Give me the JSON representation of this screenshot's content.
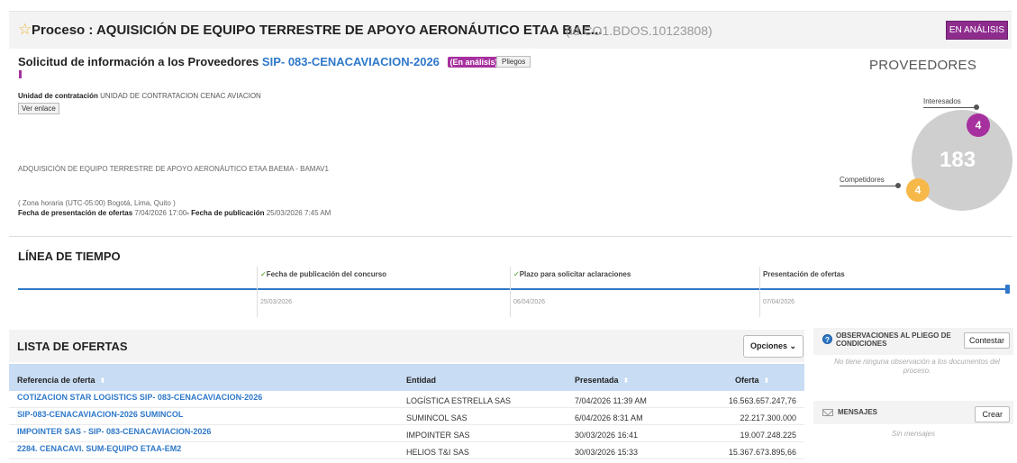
{
  "header": {
    "star_glyph": "☆",
    "title": "Proceso : AQUISICIÓN DE EQUIPO TERRESTRE DE APOYO AERONÁUTICO ETAA BAE...",
    "id": "(id.CO1.BDOS.10123808)",
    "status": "EN ANÁLISIS"
  },
  "solicitud": {
    "label": "Solicitud de información a los Proveedores",
    "code": "SIP- 083-CENACAVIACION-2026",
    "status_pill": "(En análisis)",
    "pliegos_button": "Pliegos",
    "unidad_label": "Unidad de contratación",
    "unidad_value": "UNIDAD DE CONTRATACION CENAC AVIACION",
    "ver_enlace": "Ver enlace",
    "description": "ADQUISICIÓN DE EQUIPO TERRESTRE DE APOYO AERONÁUTICO ETAA BAEMA - BAMAV1",
    "timezone": "( Zona horaria  (UTC-05:00) Bogotá, Lima, Quito )",
    "fecha_presentacion_label": "Fecha de presentación de ofertas",
    "fecha_presentacion_value": "7/04/2026 17:00",
    "fecha_publicacion_label": "- Fecha de publicación",
    "fecha_publicacion_value": "25/03/2026 7:45 AM"
  },
  "proveedores": {
    "title": "PROVEEDORES",
    "total": "183",
    "interesados_label": "Interesados",
    "interesados_count": "4",
    "competidores_label": "Competidores",
    "competidores_count": "4",
    "colors": {
      "interesados": "#a7309f",
      "competidores": "#f7b84a",
      "total": "#cfcfcf"
    }
  },
  "timeline": {
    "title": "LÍNEA DE TIEMPO",
    "check_glyph": "✓",
    "events": [
      {
        "label": "Fecha de publicación del concurso",
        "date": "25/03/2026"
      },
      {
        "label": "Plazo para solicitar aclaraciones",
        "date": "06/04/2026"
      },
      {
        "label": "Presentación de ofertas",
        "date": "07/04/2026"
      }
    ]
  },
  "ofertas": {
    "title": "LISTA DE OFERTAS",
    "opciones_button": "Opciones",
    "chevron_glyph": "⌄",
    "sort_glyph": "⬍",
    "columns": {
      "referencia": "Referencia de oferta",
      "entidad": "Entidad",
      "presentada": "Presentada",
      "oferta": "Oferta"
    },
    "rows": [
      {
        "referencia": "COTIZACION STAR LOGISTICS SIP- 083-CENACAVIACION-2026",
        "entidad": "LOGÍSTICA ESTRELLA SAS",
        "presentada": "7/04/2026 11:39 AM",
        "oferta": "16.563.657.247,76"
      },
      {
        "referencia": "SIP-083-CENACAVIACION-2026 SUMINCOL",
        "entidad": "SUMINCOL SAS",
        "presentada": "6/04/2026 8:31 AM",
        "oferta": "22.217.300.000"
      },
      {
        "referencia": "IMPOINTER SAS - SIP- 083-CENACAVIACION-2026",
        "entidad": "IMPOINTER SAS",
        "presentada": "30/03/2026 16:41",
        "oferta": "19.007.248.225"
      },
      {
        "referencia": "2284. CENACAVI. SUM-EQUIPO ETAA-EM2",
        "entidad": "HELIOS T&I SAS",
        "presentada": "30/03/2026 15:33",
        "oferta": "15.367.673.895,66"
      }
    ]
  },
  "observaciones": {
    "title": "OBSERVACIONES AL PLIEGO DE CONDICIONES",
    "contestar_button": "Contestar",
    "empty_text": "No tiene ninguna observación a los documentos del proceso.",
    "question_glyph": "?"
  },
  "mensajes": {
    "title": "MENSAJES",
    "crear_button": "Crear",
    "empty_text": "Sin mensajes"
  }
}
